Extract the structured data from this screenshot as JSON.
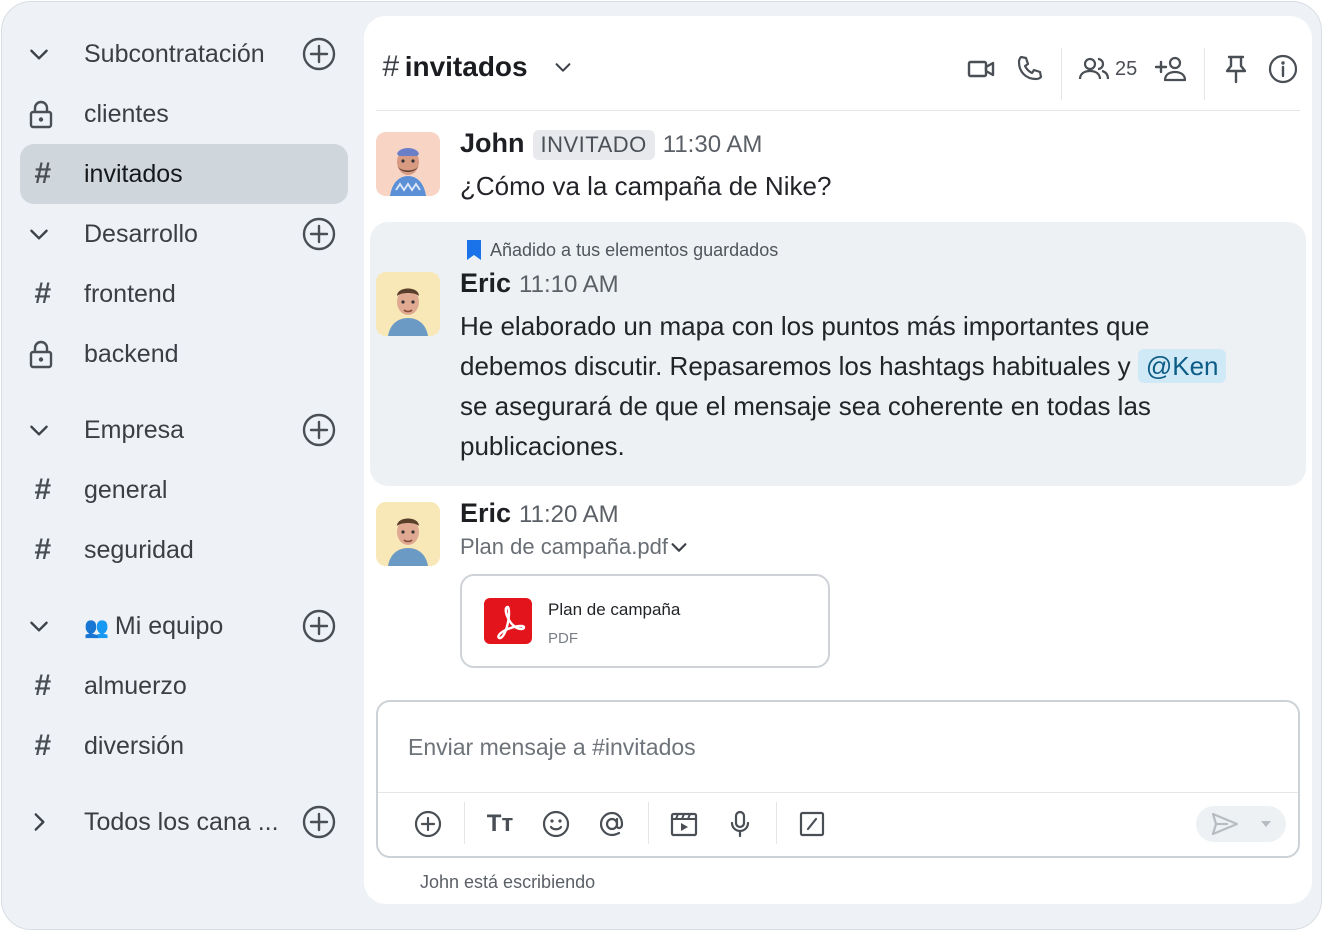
{
  "sidebar": {
    "groups": [
      {
        "label": "Subcontratación"
      },
      {
        "label": "Desarrollo"
      },
      {
        "label": "Empresa"
      },
      {
        "label": "Mi equipo"
      },
      {
        "label": "Todos los cana ..."
      }
    ],
    "channels": [
      {
        "label": "clientes",
        "icon": "lock-icon"
      },
      {
        "label": "invitados",
        "icon": "hash-icon",
        "active": true
      },
      {
        "label": "frontend",
        "icon": "hash-icon"
      },
      {
        "label": "backend",
        "icon": "lock-icon"
      },
      {
        "label": "general",
        "icon": "hash-icon"
      },
      {
        "label": "seguridad",
        "icon": "hash-icon"
      },
      {
        "label": "almuerzo",
        "icon": "hash-icon"
      },
      {
        "label": "diversión",
        "icon": "hash-icon"
      }
    ],
    "hash_symbol": "#",
    "team_emoji": "👥"
  },
  "header": {
    "hash_symbol": "#",
    "channel_name": "invitados",
    "member_count": "25"
  },
  "messages": [
    {
      "author": "John",
      "badge": "INVITADO",
      "time": "11:30 AM",
      "text": "¿Cómo va la campaña de Nike?"
    },
    {
      "saved_notice": "Añadido a tus elementos guardados",
      "author": "Eric",
      "time": "11:10 AM",
      "text_part1": "He elaborado un mapa con los puntos más importantes que",
      "text_part2": "debemos discutir. Repasaremos los hashtags habituales y",
      "mention": "@Ken",
      "text_part3": "se asegurará de que el mensaje sea coherente en todas las",
      "text_part4": "publicaciones."
    },
    {
      "author": "Eric",
      "time": "11:20 AM",
      "file_name": "Plan de campaña.pdf",
      "file_title": "Plan de campaña",
      "file_type": "PDF"
    }
  ],
  "composer": {
    "placeholder": "Enviar mensaje a #invitados",
    "tt_label": "Tт"
  },
  "typing_indicator": "John está escribiendo",
  "colors": {
    "accent": "#1a73e8",
    "pdf_red": "#e3141c",
    "active_item": "#cfd6dc",
    "mention_bg": "#cfe9f6"
  }
}
